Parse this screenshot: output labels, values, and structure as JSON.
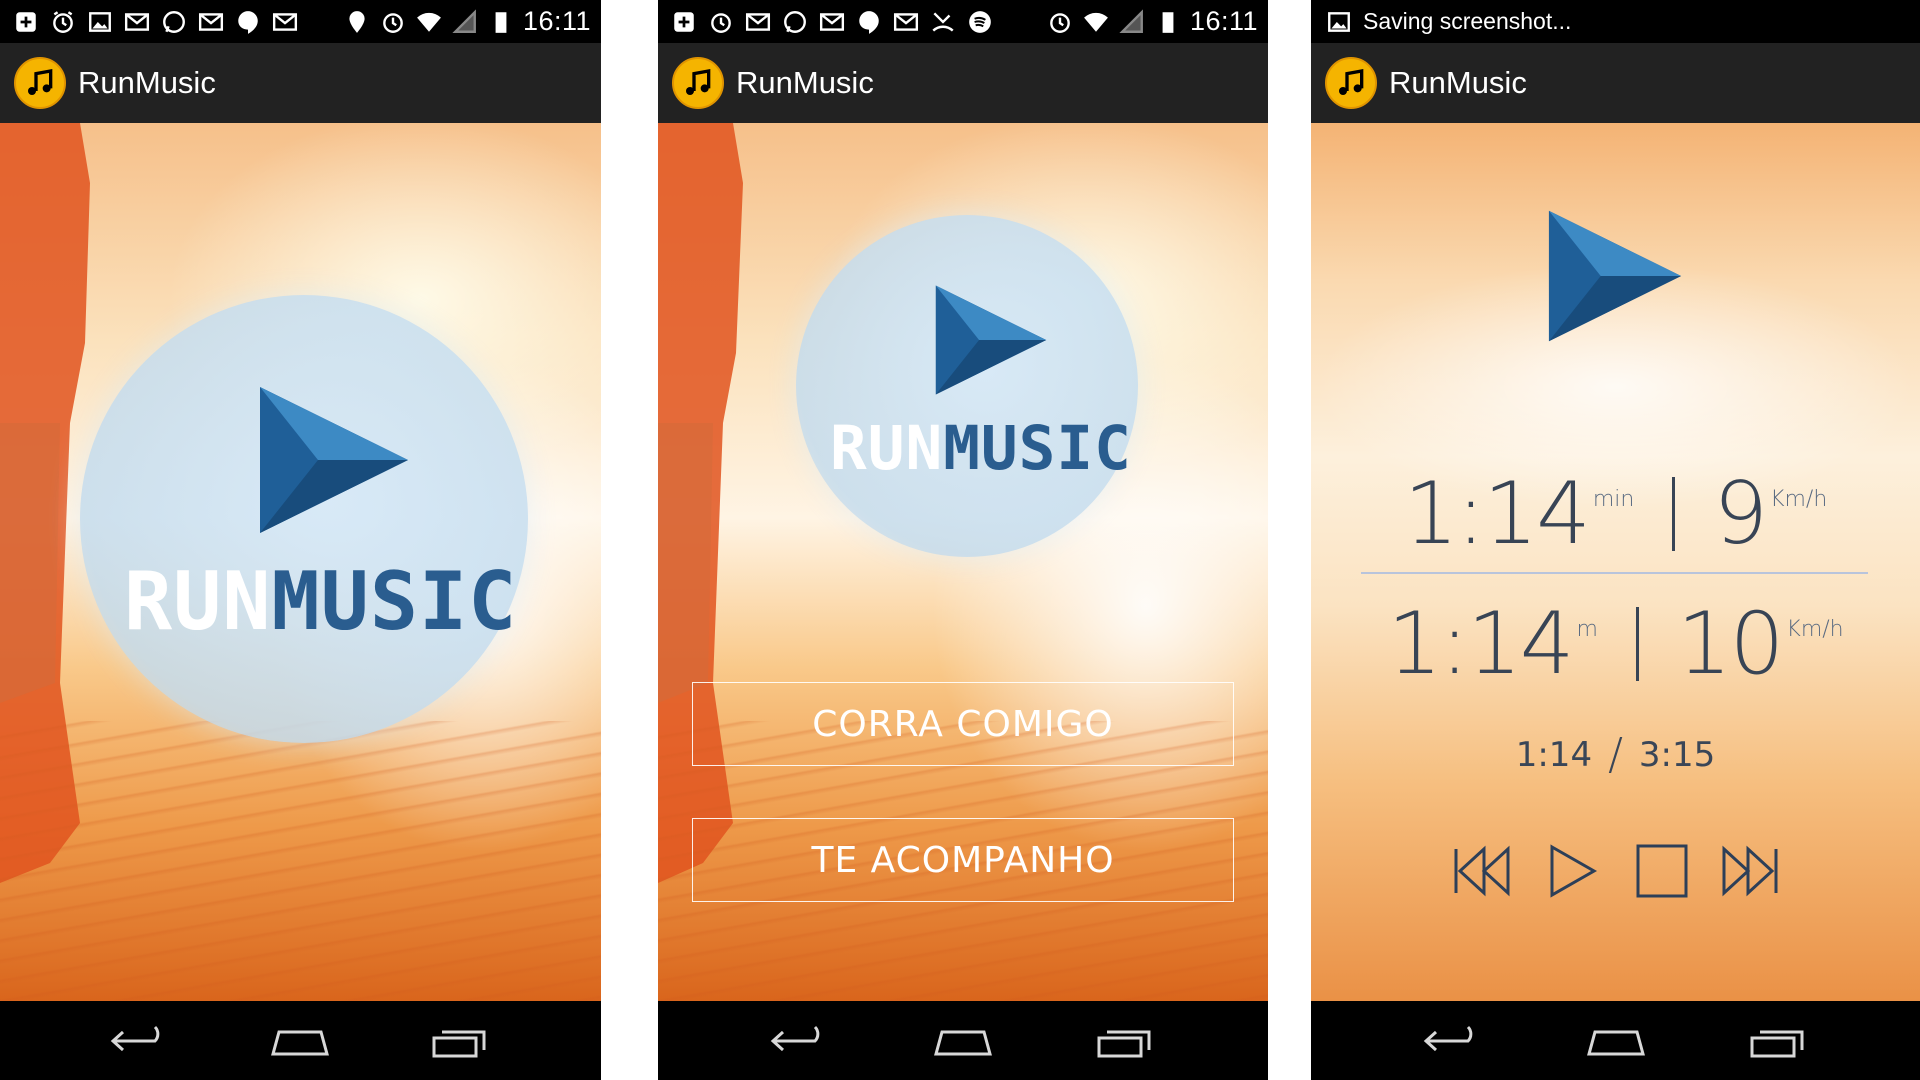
{
  "screens": [
    {
      "status_icons": [
        "plus-icon",
        "alarm-icon",
        "image-icon",
        "gmail-icon",
        "whatsapp-icon",
        "gmail-icon",
        "hangouts-icon",
        "gmail-icon"
      ],
      "status_right_icons": [
        "location-icon",
        "alarm-icon",
        "wifi-icon",
        "signal-icon",
        "battery-icon"
      ],
      "time": "16:11",
      "app_title": "RunMusic",
      "logo": {
        "word_run": "RUN",
        "word_music": "MUSIC"
      }
    },
    {
      "status_icons": [
        "plus-icon",
        "alarm-icon",
        "gmail-icon",
        "whatsapp-icon",
        "gmail-icon",
        "hangouts-icon",
        "gmail-icon",
        "missed-call-icon",
        "spotify-icon"
      ],
      "status_right_icons": [
        "alarm-icon",
        "wifi-icon",
        "signal-icon",
        "battery-icon"
      ],
      "time": "16:11",
      "app_title": "RunMusic",
      "logo": {
        "word_run": "RUN",
        "word_music": "MUSIC"
      },
      "buttons": {
        "run_with_me": "CORRA COMIGO",
        "follow_you": "TE ACOMPANHO"
      }
    },
    {
      "status_text": "Saving screenshot...",
      "app_title": "RunMusic",
      "stats": {
        "row1": {
          "time": "1:14",
          "time_unit": "min",
          "speed": "9",
          "speed_unit": "Km/h"
        },
        "row2": {
          "time": "1:14",
          "time_unit": "m",
          "speed": "10",
          "speed_unit": "Km/h"
        }
      },
      "progress": {
        "elapsed": "1:14",
        "separator": "/",
        "total": "3:15"
      },
      "controls": [
        "skip-previous-icon",
        "play-icon",
        "stop-icon",
        "skip-next-icon"
      ]
    }
  ],
  "colors": {
    "accent_blue": "#2a5d8f",
    "app_icon_yellow": "#f5b400",
    "actionbar": "#222222",
    "text_dark": "#384455"
  }
}
